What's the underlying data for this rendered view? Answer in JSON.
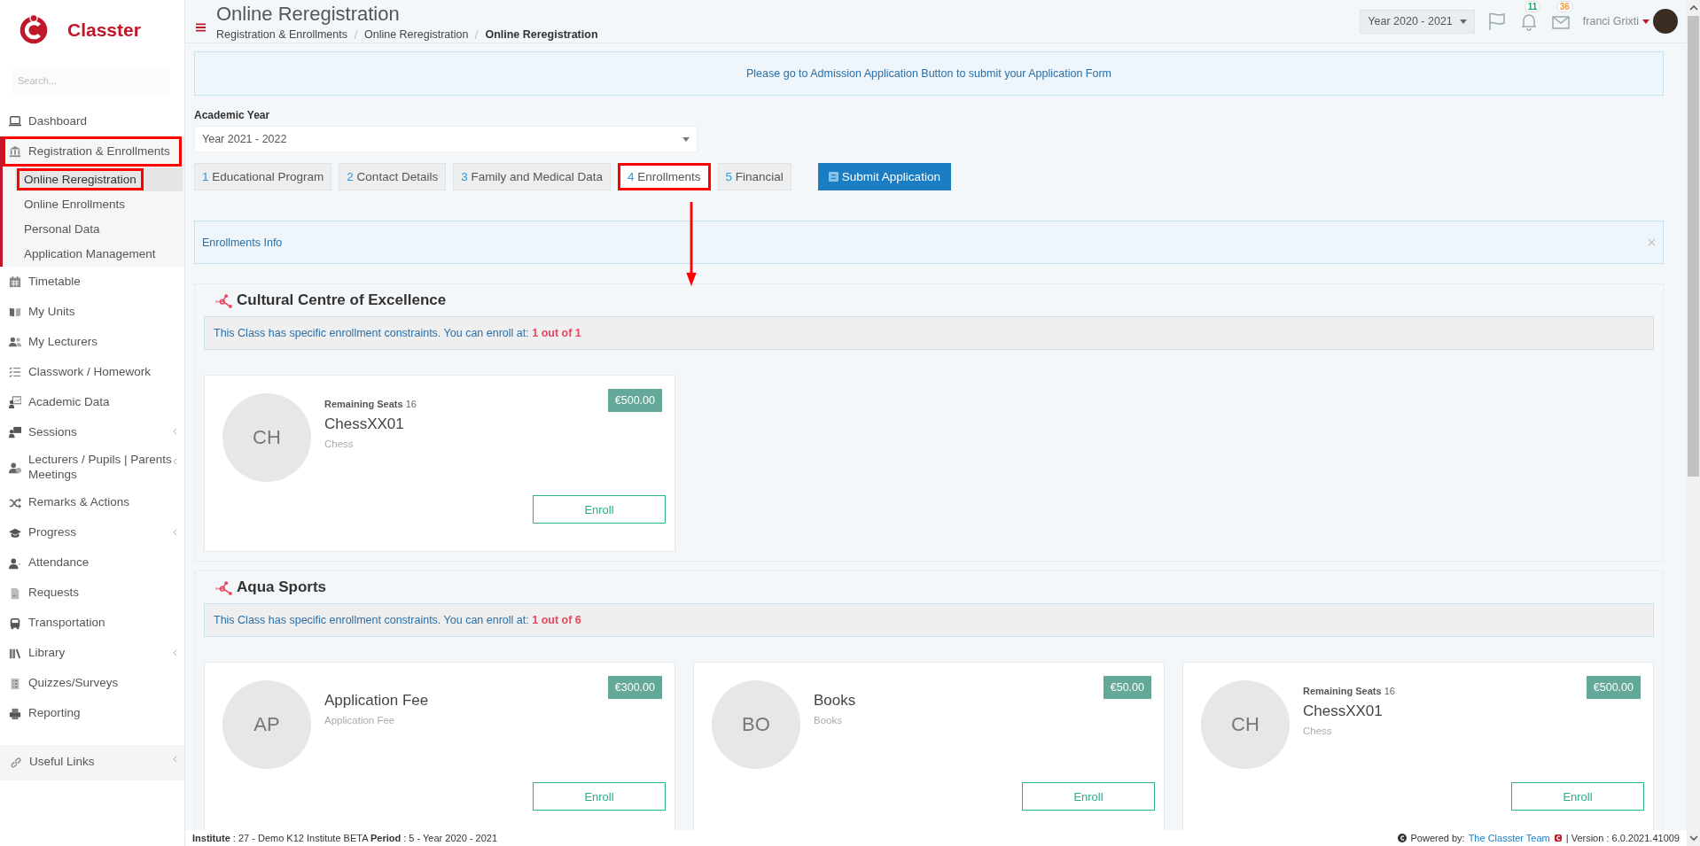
{
  "brand": {
    "name": "Classter"
  },
  "sidebar": {
    "search_placeholder": "Search...",
    "items": [
      {
        "label": "Dashboard",
        "has_submenu": false,
        "expanded": false,
        "highlighted": false
      },
      {
        "label": "Registration & Enrollments",
        "has_submenu": false,
        "expanded": true,
        "highlighted": true,
        "children": [
          {
            "label": "Online Reregistration",
            "selected": true,
            "highlighted": true
          },
          {
            "label": "Online Enrollments",
            "selected": false,
            "highlighted": false
          },
          {
            "label": "Personal Data",
            "selected": false,
            "highlighted": false
          },
          {
            "label": "Application Management",
            "selected": false,
            "highlighted": false
          }
        ]
      },
      {
        "label": "Timetable",
        "has_submenu": false,
        "expanded": false,
        "highlighted": false
      },
      {
        "label": "My Units",
        "has_submenu": false,
        "expanded": false,
        "highlighted": false
      },
      {
        "label": "My Lecturers",
        "has_submenu": false,
        "expanded": false,
        "highlighted": false
      },
      {
        "label": "Classwork / Homework",
        "has_submenu": false,
        "expanded": false,
        "highlighted": false
      },
      {
        "label": "Academic Data",
        "has_submenu": false,
        "expanded": false,
        "highlighted": false
      },
      {
        "label": "Sessions",
        "has_submenu": true,
        "expanded": false,
        "highlighted": false
      },
      {
        "label": "Lecturers / Pupils | Parents Meetings",
        "has_submenu": true,
        "expanded": false,
        "highlighted": false
      },
      {
        "label": "Remarks & Actions",
        "has_submenu": false,
        "expanded": false,
        "highlighted": false
      },
      {
        "label": "Progress",
        "has_submenu": true,
        "expanded": false,
        "highlighted": false
      },
      {
        "label": "Attendance",
        "has_submenu": false,
        "expanded": false,
        "highlighted": false
      },
      {
        "label": "Requests",
        "has_submenu": false,
        "expanded": false,
        "highlighted": false
      },
      {
        "label": "Transportation",
        "has_submenu": false,
        "expanded": false,
        "highlighted": false
      },
      {
        "label": "Library",
        "has_submenu": true,
        "expanded": false,
        "highlighted": false
      },
      {
        "label": "Quizzes/Surveys",
        "has_submenu": false,
        "expanded": false,
        "highlighted": false
      },
      {
        "label": "Reporting",
        "has_submenu": false,
        "expanded": false,
        "highlighted": false
      }
    ],
    "footer_item": {
      "label": "Useful Links",
      "has_submenu": true
    }
  },
  "header": {
    "title": "Online Reregistration",
    "breadcrumb": [
      "Registration & Enrollments",
      "Online Reregistration",
      "Online Reregistration"
    ],
    "year": "Year 2020 - 2021",
    "notifications": "11",
    "messages": "36",
    "user": "franci Grixti"
  },
  "notice": "Please go to Admission Application Button to submit your Application Form",
  "academic_year": {
    "label": "Academic Year",
    "value": "Year 2021 - 2022"
  },
  "steps": [
    {
      "number": "1",
      "label": "Educational Program",
      "selected": false,
      "highlighted": false
    },
    {
      "number": "2",
      "label": "Contact Details",
      "selected": false,
      "highlighted": false
    },
    {
      "number": "3",
      "label": "Family and Medical Data",
      "selected": false,
      "highlighted": false
    },
    {
      "number": "4",
      "label": "Enrollments",
      "selected": true,
      "highlighted": true
    },
    {
      "number": "5",
      "label": "Financial",
      "selected": false,
      "highlighted": false
    }
  ],
  "submit_button": "Submit Application",
  "info_bar": "Enrollments Info",
  "annotation_arrow": true,
  "sections": [
    {
      "title": "Cultural Centre of Excellence",
      "constraint": "This Class has specific enrollment constraints. You can enroll at:",
      "constraint_value": "1 out of 1",
      "cards": [
        {
          "initials": "CH",
          "seats_label": "Remaining Seats",
          "seats": "16",
          "title": "ChessXX01",
          "subtitle": "Chess",
          "price": "€500.00",
          "button": "Enroll"
        }
      ]
    },
    {
      "title": "Aqua Sports",
      "constraint": "This Class has specific enrollment constraints. You can enroll at:",
      "constraint_value": "1 out of 6",
      "cards": [
        {
          "initials": "AP",
          "title": "Application Fee",
          "subtitle": "Application Fee",
          "price": "€300.00",
          "button": "Enroll"
        },
        {
          "initials": "BO",
          "title": "Books",
          "subtitle": "Books",
          "price": "€50.00",
          "button": "Enroll"
        },
        {
          "initials": "CH",
          "seats_label": "Remaining Seats",
          "seats": "16",
          "title": "ChessXX01",
          "subtitle": "Chess",
          "price": "€500.00",
          "button": "Enroll"
        }
      ]
    }
  ],
  "footer": {
    "left": "**Institute** : 27 - Demo K12 Institute BETA **Period** : 5 - Year 2020 - 2021",
    "powered": "Powered by:",
    "team": "The Classter Team",
    "version": "| Version : 6.0.2021.41009"
  }
}
